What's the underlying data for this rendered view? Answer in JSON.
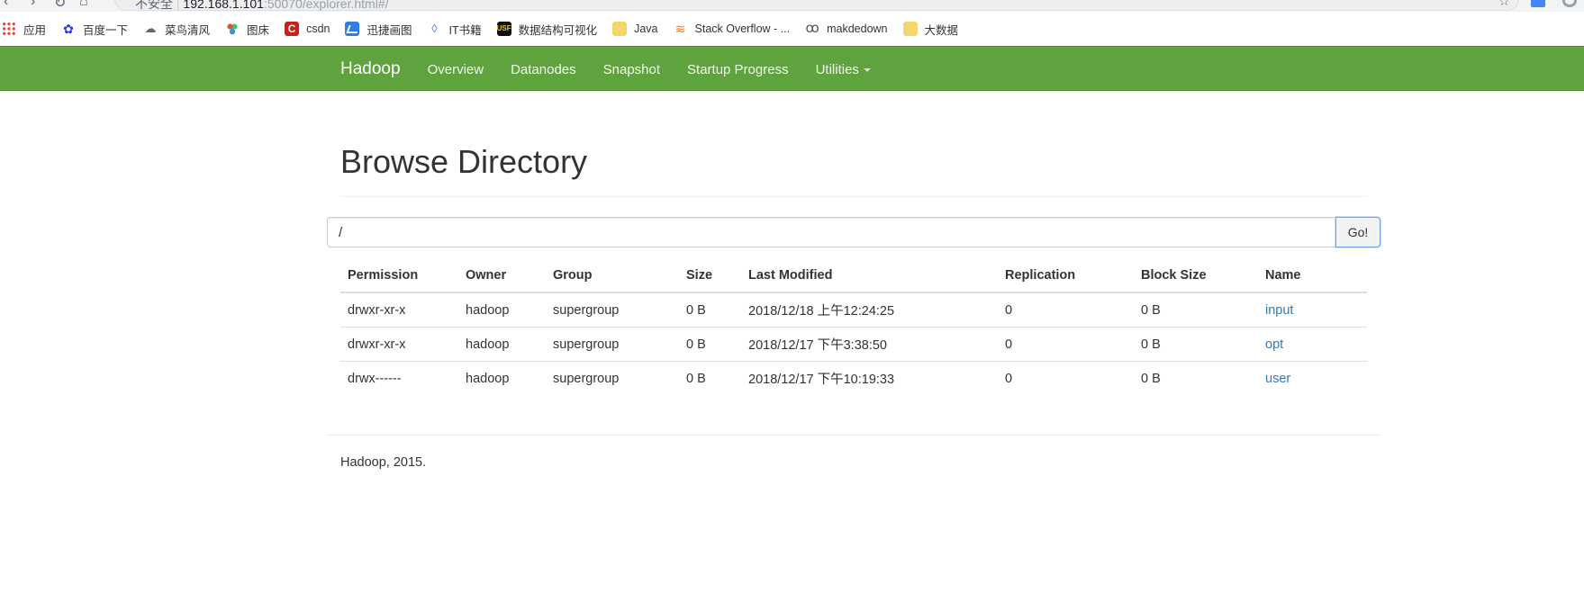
{
  "browser": {
    "address": {
      "security_label": "不安全",
      "host": "192.168.1.101",
      "path": ":50070/explorer.html#/"
    }
  },
  "bookmarks": [
    {
      "label": "应用",
      "icon": "apps-grid-icon"
    },
    {
      "label": "百度一下",
      "icon": "baidu-paw-icon"
    },
    {
      "label": "菜鸟清风",
      "icon": "cainiao-icon"
    },
    {
      "label": "图床",
      "icon": "tuchuang-icon"
    },
    {
      "label": "csdn",
      "icon": "csdn-icon"
    },
    {
      "label": "迅捷画图",
      "icon": "xunjie-icon"
    },
    {
      "label": "IT书籍",
      "icon": "it-books-icon"
    },
    {
      "label": "数据结构可视化",
      "icon": "usf-icon"
    },
    {
      "label": "Java",
      "icon": "folder-icon"
    },
    {
      "label": "Stack Overflow - ...",
      "icon": "stackoverflow-icon"
    },
    {
      "label": "makdedown",
      "icon": "markdown-icon"
    },
    {
      "label": "大数据",
      "icon": "folder-icon"
    }
  ],
  "navbar": {
    "brand": "Hadoop",
    "links": [
      "Overview",
      "Datanodes",
      "Snapshot",
      "Startup Progress",
      "Utilities"
    ],
    "bg_color": "#5fa33e"
  },
  "main": {
    "title": "Browse Directory",
    "path_value": "/",
    "go_label": "Go!",
    "columns": [
      "Permission",
      "Owner",
      "Group",
      "Size",
      "Last Modified",
      "Replication",
      "Block Size",
      "Name"
    ],
    "rows": [
      [
        "drwxr-xr-x",
        "hadoop",
        "supergroup",
        "0 B",
        "2018/12/18 上午12:24:25",
        "0",
        "0 B",
        "input"
      ],
      [
        "drwxr-xr-x",
        "hadoop",
        "supergroup",
        "0 B",
        "2018/12/17 下午3:38:50",
        "0",
        "0 B",
        "opt"
      ],
      [
        "drwx------",
        "hadoop",
        "supergroup",
        "0 B",
        "2018/12/17 下午10:19:33",
        "0",
        "0 B",
        "user"
      ]
    ],
    "link_color": "#337ab7"
  },
  "footer": {
    "text": "Hadoop, 2015."
  }
}
